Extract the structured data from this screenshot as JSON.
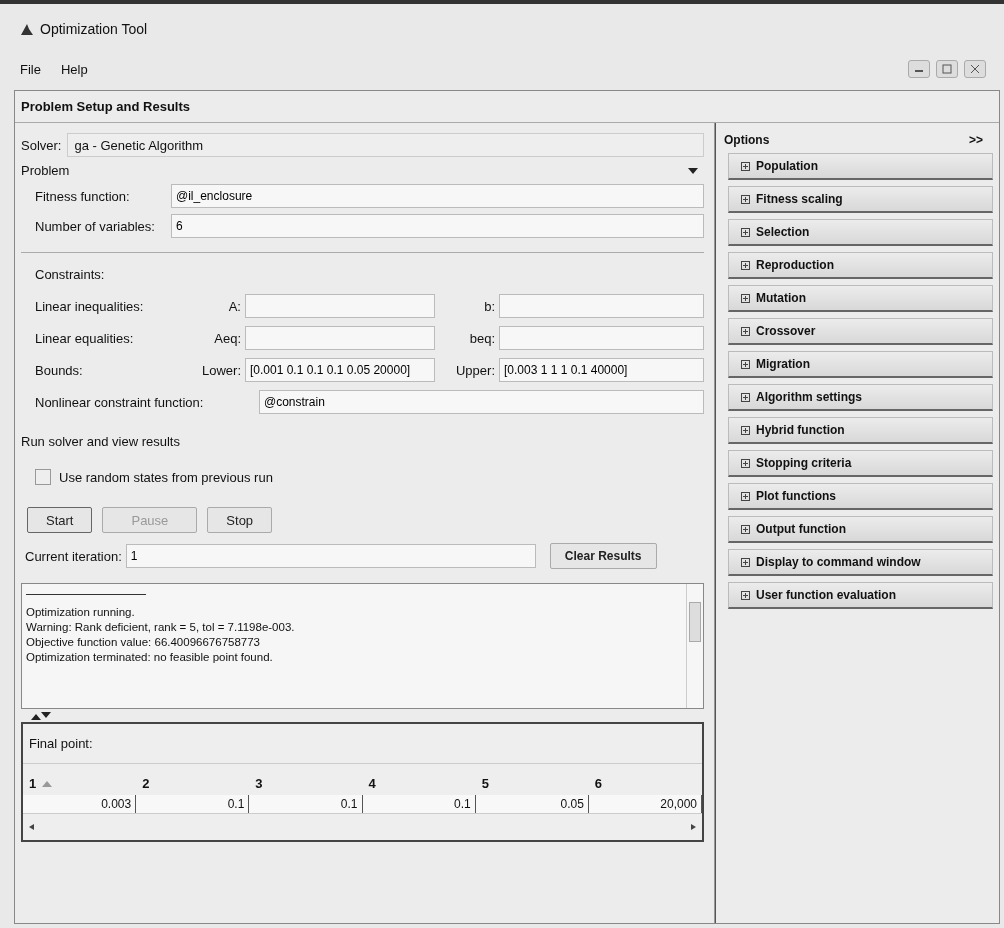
{
  "window": {
    "title": "Optimization Tool"
  },
  "menu": [
    "File",
    "Help"
  ],
  "panel_title": "Problem Setup and Results",
  "solver": {
    "label": "Solver:",
    "value": "ga - Genetic Algorithm"
  },
  "problem": {
    "title": "Problem",
    "fields": [
      {
        "label": "Fitness function:",
        "value": "@il_enclosure"
      },
      {
        "label": "Number of variables:",
        "value": "6"
      }
    ]
  },
  "constraints": {
    "title": "Constraints:",
    "rows": [
      {
        "label": "Linear inequalities:",
        "left_label": "A:",
        "left_value": "",
        "right_label": "b:",
        "right_value": ""
      },
      {
        "label": "Linear equalities:",
        "left_label": "Aeq:",
        "left_value": "",
        "right_label": "beq:",
        "right_value": ""
      },
      {
        "label": "Bounds:",
        "left_label": "Lower:",
        "left_value": "[0.001 0.1 0.1 0.1 0.05 20000]",
        "right_label": "Upper:",
        "right_value": "[0.003 1 1 1 0.1 40000]"
      }
    ],
    "nonlinear": {
      "label": "Nonlinear constraint function:",
      "value": "@constrain"
    }
  },
  "run": {
    "title": "Run solver and view results",
    "checkbox": {
      "label": "Use random states from previous run",
      "checked": false
    },
    "buttons": [
      {
        "label": "Start",
        "disabled": false
      },
      {
        "label": "Pause",
        "disabled": true
      },
      {
        "label": "Stop",
        "disabled": false
      }
    ],
    "iteration": {
      "label": "Current iteration:",
      "value": "1"
    },
    "clear_button": "Clear Results"
  },
  "output": [
    "Optimization running.",
    "Warning: Rank deficient, rank = 5,  tol =   7.1198e-003.",
    "Objective function value: 66.40096676758773",
    "Optimization terminated: no feasible point found."
  ],
  "final_point": {
    "title": "Final point:",
    "columns": [
      {
        "label": "1",
        "sorted": true
      },
      {
        "label": "2",
        "sorted": false
      },
      {
        "label": "3",
        "sorted": false
      },
      {
        "label": "4",
        "sorted": false
      },
      {
        "label": "5",
        "sorted": false
      },
      {
        "label": "6",
        "sorted": false
      }
    ],
    "values": [
      "0.003",
      "0.1",
      "0.1",
      "0.1",
      "0.05",
      "20,000"
    ]
  },
  "options": {
    "title": "Options",
    "toggle": ">>",
    "items": [
      {
        "label": "Population",
        "expanded": false
      },
      {
        "label": "Fitness scaling",
        "expanded": false
      },
      {
        "label": "Selection",
        "expanded": false
      },
      {
        "label": "Reproduction",
        "expanded": false
      },
      {
        "label": "Mutation",
        "expanded": false
      },
      {
        "label": "Crossover",
        "expanded": false
      },
      {
        "label": "Migration",
        "expanded": false
      },
      {
        "label": "Algorithm settings",
        "expanded": false
      },
      {
        "label": "Hybrid function",
        "expanded": false
      },
      {
        "label": "Stopping criteria",
        "expanded": false
      },
      {
        "label": "Plot functions",
        "expanded": false
      },
      {
        "label": "Output function",
        "expanded": false
      },
      {
        "label": "Display to command window",
        "expanded": false
      },
      {
        "label": "User function evaluation",
        "expanded": false
      }
    ]
  }
}
